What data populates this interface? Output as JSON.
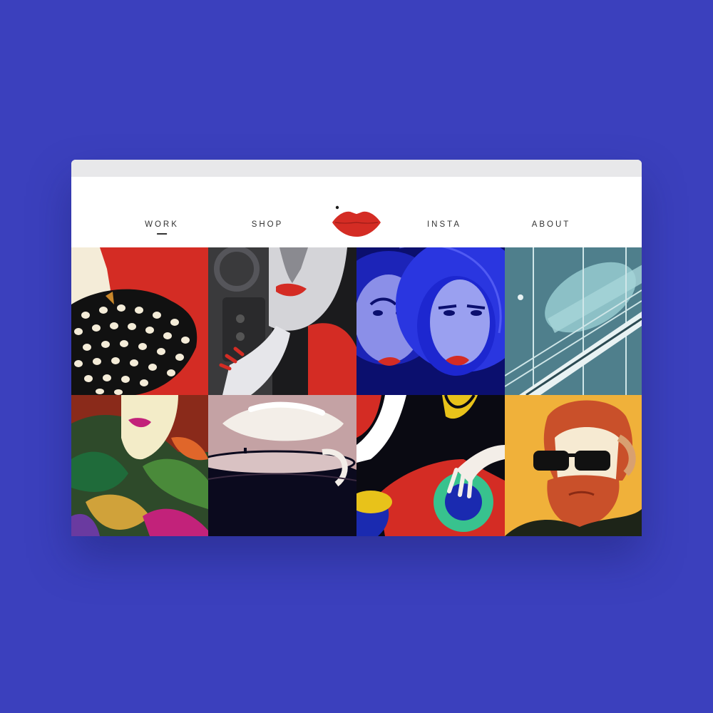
{
  "nav": {
    "items": [
      {
        "label": "WORK",
        "active": true
      },
      {
        "label": "SHOP",
        "active": false
      },
      {
        "label": "INSTA",
        "active": false
      },
      {
        "label": "ABOUT",
        "active": false
      }
    ],
    "logo_icon": "lips-icon"
  },
  "colors": {
    "background": "#3b40bd",
    "accent_red": "#d42c24",
    "titlebar": "#e8e8ea"
  },
  "gallery": {
    "tiles": [
      {
        "icon": "polka-dot-hat-portrait"
      },
      {
        "icon": "red-lips-hand-portrait"
      },
      {
        "icon": "astronaut-women-portrait"
      },
      {
        "icon": "bridge-airship-illustration"
      },
      {
        "icon": "tropical-leaves-portrait"
      },
      {
        "icon": "coffee-cup-illustration"
      },
      {
        "icon": "hand-on-lamp-illustration"
      },
      {
        "icon": "bearded-man-sunglasses-portrait"
      }
    ]
  }
}
